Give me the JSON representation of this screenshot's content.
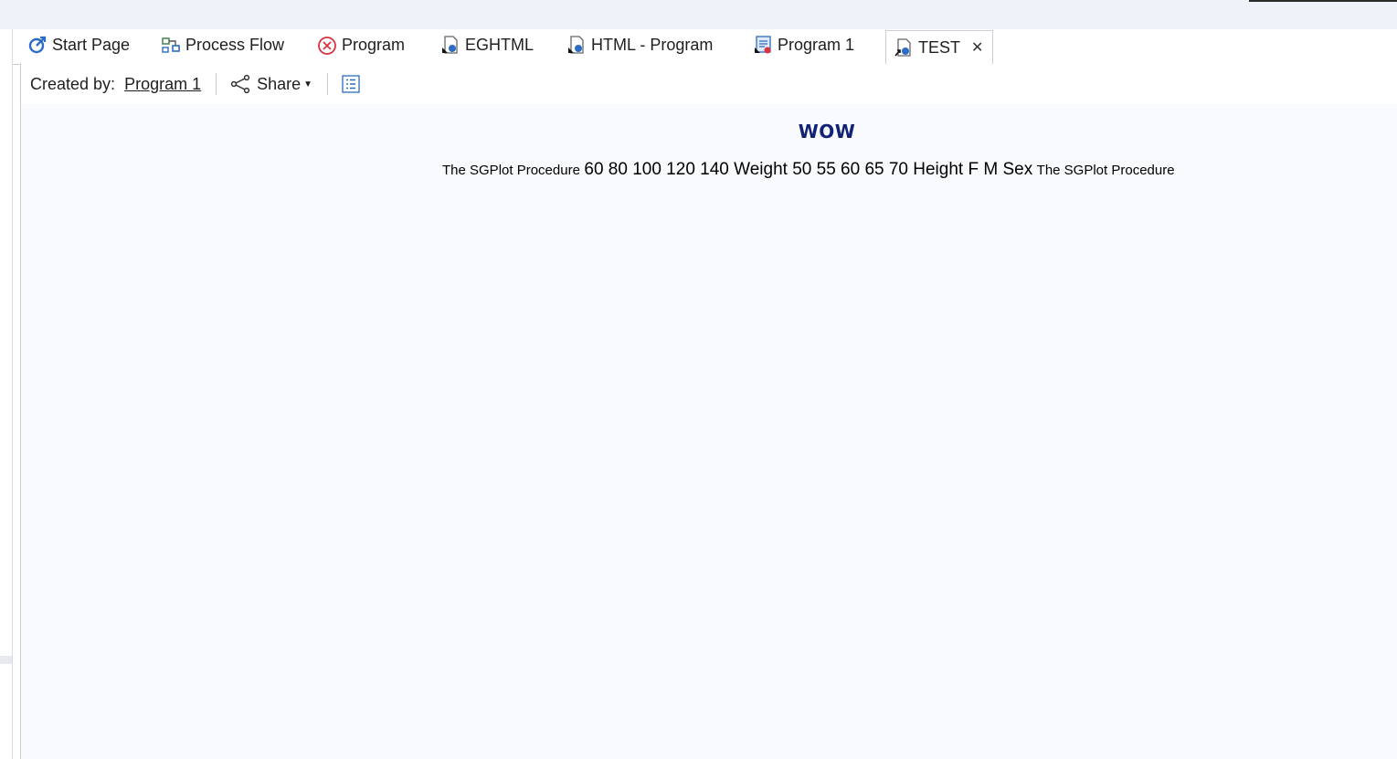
{
  "tabs": [
    {
      "label": "Start Page",
      "icon": "start-page-icon",
      "active": false
    },
    {
      "label": "Process Flow",
      "icon": "process-flow-icon",
      "active": false
    },
    {
      "label": "Program",
      "icon": "error-circle-icon",
      "active": false
    },
    {
      "label": "EGHTML",
      "icon": "html-result-icon",
      "active": false
    },
    {
      "label": "HTML - Program",
      "icon": "html-result-icon",
      "active": false
    },
    {
      "label": "Program 1",
      "icon": "program-error-icon",
      "active": false
    },
    {
      "label": "TEST",
      "icon": "html-result-icon",
      "active": true
    }
  ],
  "toolbar": {
    "created_by_label": "Created by:",
    "created_by_value": "Program 1",
    "share_label": "Share"
  },
  "results": {
    "title": "WOW",
    "alt_text_parts": [
      "The SGPlot Procedure",
      "60 80 100 120 140 Weight 50 55 60 65 70 Height F M Sex",
      "The SGPlot Procedure"
    ]
  },
  "colors": {
    "accent_blue": "#2b6cc4",
    "error_red": "#d9333f",
    "title_navy": "#112277"
  }
}
